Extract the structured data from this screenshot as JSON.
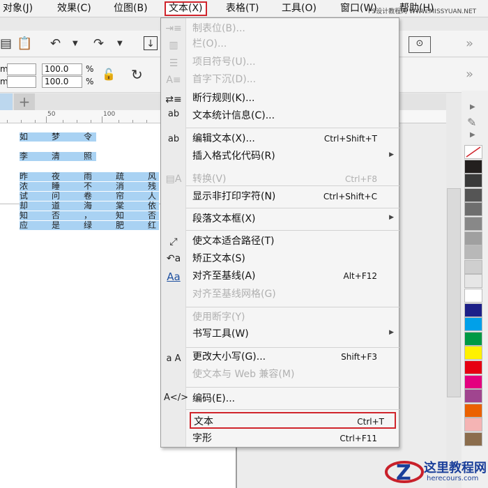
{
  "menubar": {
    "items": [
      "对象(J)",
      "效果(C)",
      "位图(B)",
      "文本(X)",
      "表格(T)",
      "工具(O)",
      "窗口(W)",
      "帮助(H)"
    ],
    "watermark": "PS设计教程网 WWW.MISSYUAN.NET"
  },
  "toolbar": {
    "field_width": "100.0",
    "field_height": "100.0",
    "unit_percent": "%",
    "unit_mm": "m",
    "chevron": "»"
  },
  "ruler": {
    "labels": [
      "50",
      "100"
    ]
  },
  "document": {
    "poem_lines": [
      [
        "如",
        "梦",
        "令"
      ],
      [
        "李",
        "清",
        "照"
      ],
      [
        "昨",
        "夜",
        "雨",
        "疏",
        "风"
      ],
      [
        "浓",
        "睡",
        "不",
        "消",
        "残"
      ],
      [
        "试",
        "问",
        "卷",
        "帘",
        "人"
      ],
      [
        "却",
        "道",
        "海",
        "棠",
        "依"
      ],
      [
        "知",
        "否",
        "，",
        "知",
        "否"
      ],
      [
        "应",
        "是",
        "绿",
        "肥",
        "红"
      ]
    ]
  },
  "menu": {
    "items": [
      {
        "label": "制表位(B)...",
        "shortcut": "",
        "disabled": true,
        "submenu": false
      },
      {
        "label": "栏(O)...",
        "shortcut": "",
        "disabled": true,
        "submenu": false
      },
      {
        "label": "项目符号(U)...",
        "shortcut": "",
        "disabled": true,
        "submenu": false
      },
      {
        "label": "首字下沉(D)...",
        "shortcut": "",
        "disabled": true,
        "submenu": false
      },
      {
        "label": "断行规则(K)...",
        "shortcut": "",
        "disabled": false,
        "submenu": false
      },
      {
        "label": "文本统计信息(C)...",
        "shortcut": "",
        "disabled": false,
        "submenu": false
      },
      {
        "label": "编辑文本(X)...",
        "shortcut": "Ctrl+Shift+T",
        "disabled": false,
        "submenu": false
      },
      {
        "label": "插入格式化代码(R)",
        "shortcut": "",
        "disabled": false,
        "submenu": true
      },
      {
        "label": "转换(V)",
        "shortcut": "Ctrl+F8",
        "disabled": true,
        "submenu": false
      },
      {
        "label": "显示非打印字符(N)",
        "shortcut": "Ctrl+Shift+C",
        "disabled": false,
        "submenu": false
      },
      {
        "label": "段落文本框(X)",
        "shortcut": "",
        "disabled": false,
        "submenu": true
      },
      {
        "label": "使文本适合路径(T)",
        "shortcut": "",
        "disabled": false,
        "submenu": false
      },
      {
        "label": "矫正文本(S)",
        "shortcut": "",
        "disabled": false,
        "submenu": false
      },
      {
        "label": "对齐至基线(A)",
        "shortcut": "Alt+F12",
        "disabled": false,
        "submenu": false
      },
      {
        "label": "对齐至基线网格(G)",
        "shortcut": "",
        "disabled": true,
        "submenu": false
      },
      {
        "label": "使用断字(Y)",
        "shortcut": "",
        "disabled": true,
        "submenu": false
      },
      {
        "label": "书写工具(W)",
        "shortcut": "",
        "disabled": false,
        "submenu": true
      },
      {
        "label": "更改大小写(G)...",
        "shortcut": "Shift+F3",
        "disabled": false,
        "submenu": false
      },
      {
        "label": "使文本与 Web 兼容(M)",
        "shortcut": "",
        "disabled": true,
        "submenu": false
      },
      {
        "label": "编码(E)...",
        "shortcut": "",
        "disabled": false,
        "submenu": false
      },
      {
        "label": "文本",
        "shortcut": "Ctrl+T",
        "disabled": false,
        "submenu": false
      },
      {
        "label": "字形",
        "shortcut": "Ctrl+F11",
        "disabled": false,
        "submenu": false
      }
    ],
    "gutter_text": {
      "ab_stats": "ab",
      "ab_edit": "ab",
      "aa": "a A",
      "aa_baseline": "Aa"
    }
  },
  "palette": {
    "colors": [
      "#ffffff",
      "#231f1e",
      "#3a3a3a",
      "#555555",
      "#6e6e6e",
      "#888888",
      "#a0a0a0",
      "#b8b8b8",
      "#cfcfcf",
      "#e6e6e6",
      "#ffffff",
      "#1d2088",
      "#00a0e9",
      "#009944",
      "#fff100",
      "#e60012",
      "#e4007f",
      "#a0458f",
      "#eb6100",
      "#f5b4b4",
      "#8b6d4d"
    ]
  },
  "logo": {
    "title": "这里教程网",
    "url": "herecours.com"
  }
}
